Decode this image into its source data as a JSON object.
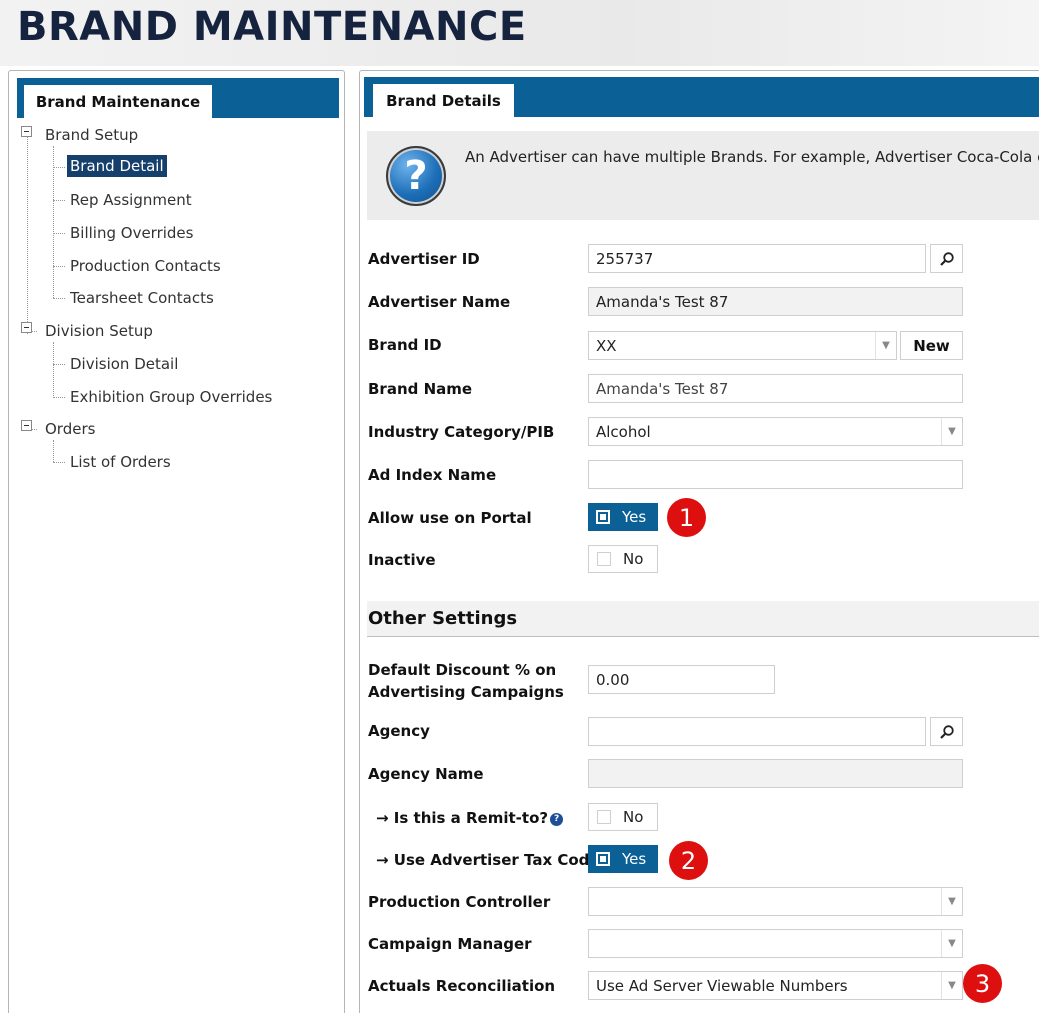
{
  "page": {
    "title": "BRAND MAINTENANCE"
  },
  "sidebar": {
    "tab_label": "Brand Maintenance",
    "groups": [
      {
        "label": "Brand Setup",
        "items": [
          "Brand Detail",
          "Rep Assignment",
          "Billing Overrides",
          "Production Contacts",
          "Tearsheet Contacts"
        ]
      },
      {
        "label": "Division Setup",
        "items": [
          "Division Detail",
          "Exhibition Group Overrides"
        ]
      },
      {
        "label": "Orders",
        "items": [
          "List of Orders"
        ]
      }
    ],
    "selected": "Brand Detail"
  },
  "main": {
    "tab_label": "Brand Details",
    "info_text": "An Advertiser can have multiple Brands. For example, Advertiser Coca-Cola could",
    "help_icon_glyph": "?",
    "fields": {
      "advertiser_id": {
        "label": "Advertiser ID",
        "value": "255737"
      },
      "advertiser_name": {
        "label": "Advertiser Name",
        "value": "Amanda's Test 87"
      },
      "brand_id": {
        "label": "Brand ID",
        "value": "XX",
        "new_label": "New"
      },
      "brand_name": {
        "label": "Brand Name",
        "value": "Amanda's Test 87"
      },
      "industry_category": {
        "label": "Industry Category/PIB",
        "value": "Alcohol"
      },
      "ad_index_name": {
        "label": "Ad Index Name",
        "value": ""
      },
      "allow_portal": {
        "label": "Allow use on Portal",
        "value": "Yes"
      },
      "inactive": {
        "label": "Inactive",
        "value": "No"
      }
    },
    "other_settings": {
      "title": "Other Settings",
      "default_discount": {
        "label_line1": "Default Discount % on",
        "label_line2": "Advertising Campaigns",
        "value": "0.00"
      },
      "agency": {
        "label": "Agency",
        "value": ""
      },
      "agency_name": {
        "label": "Agency Name",
        "value": ""
      },
      "remit_to": {
        "label": "→ Is this a Remit-to?",
        "value": "No"
      },
      "use_tax_code": {
        "label": "→ Use Advertiser Tax Code",
        "value": "Yes"
      },
      "production_controller": {
        "label": "Production Controller",
        "value": ""
      },
      "campaign_manager": {
        "label": "Campaign Manager",
        "value": ""
      },
      "actuals_reconciliation": {
        "label": "Actuals Reconciliation",
        "value": "Use Ad Server Viewable Numbers"
      }
    },
    "badges": [
      "1",
      "2",
      "3"
    ]
  },
  "colors": {
    "tab_blue": "#0b6195",
    "title_navy": "#15233f",
    "badge_red": "#de0f0f",
    "selected_bg": "#15406c"
  }
}
